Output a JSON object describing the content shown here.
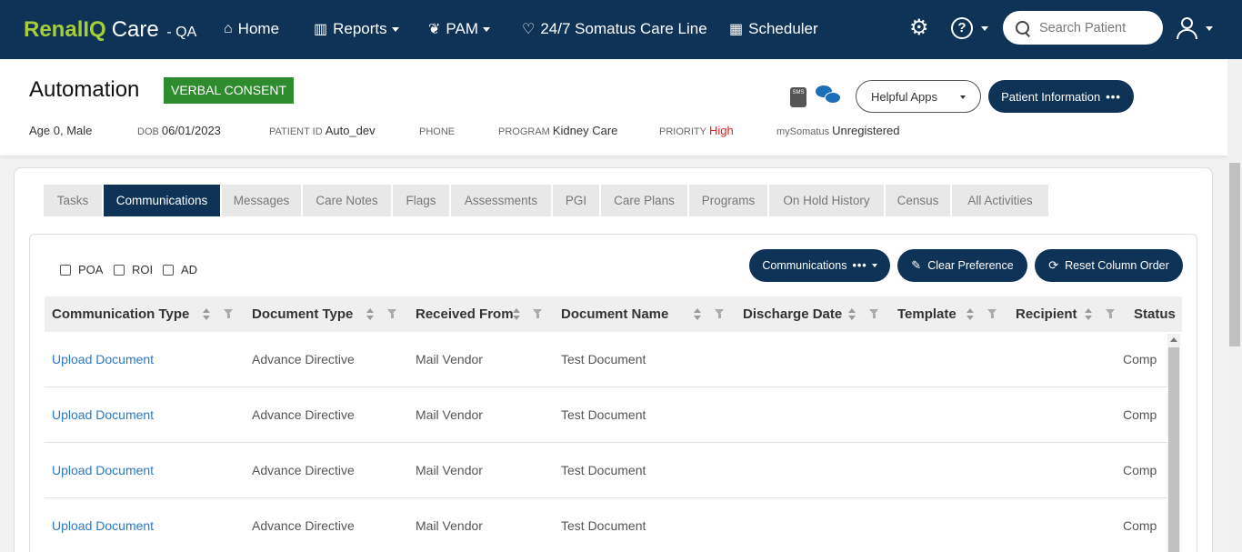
{
  "brand": {
    "part1": "Renal",
    "part2": "IQ",
    "part3": "Care",
    "env": "- QA"
  },
  "nav": {
    "home": "Home",
    "reports": "Reports",
    "pam": "PAM",
    "careline": "24/7 Somatus Care Line",
    "scheduler": "Scheduler",
    "search_placeholder": "Search Patient",
    "icons": [
      "home-icon",
      "bar-chart-icon",
      "leaf-icon",
      "heartbeat-icon",
      "calendar-icon",
      "gear-icon",
      "help-icon",
      "search-icon",
      "user-icon"
    ]
  },
  "patient": {
    "name": "Automation",
    "consent": "VERBAL CONSENT",
    "age_sex": "Age 0, Male",
    "dob_label": "DOB",
    "dob": "06/01/2023",
    "id_label": "PATIENT ID",
    "id": "Auto_dev",
    "phone_label": "PHONE",
    "program_label": "PROGRAM",
    "program": "Kidney Care",
    "priority_label": "PRIORITY",
    "priority": "High",
    "mysomatus_label": "mySomatus",
    "mysomatus": "Unregistered",
    "sms_label": "SMS",
    "helpful_apps": "Helpful Apps",
    "patient_info": "Patient Information",
    "dots": "•••"
  },
  "tabs": [
    "Tasks",
    "Communications",
    "Messages",
    "Care Notes",
    "Flags",
    "Assessments",
    "PGI",
    "Care Plans",
    "Programs",
    "On Hold History",
    "Census",
    "All Activities"
  ],
  "active_tab": "Communications",
  "filters": {
    "poa": "POA",
    "roi": "ROI",
    "ad": "AD"
  },
  "actions": {
    "communications": "Communications",
    "clear_pref": "Clear Preference",
    "reset_order": "Reset Column Order"
  },
  "table": {
    "columns": [
      "Communication Type",
      "Document Type",
      "Received From",
      "Document Name",
      "Discharge Date",
      "Template",
      "Recipient",
      "Status"
    ],
    "rows": [
      [
        "Upload Document",
        "Advance Directive",
        "Mail Vendor",
        "Test Document",
        "",
        "",
        "",
        "Comp"
      ],
      [
        "Upload Document",
        "Advance Directive",
        "Mail Vendor",
        "Test Document",
        "",
        "",
        "",
        "Comp"
      ],
      [
        "Upload Document",
        "Advance Directive",
        "Mail Vendor",
        "Test Document",
        "",
        "",
        "",
        "Comp"
      ],
      [
        "Upload Document",
        "Advance Directive",
        "Mail Vendor",
        "Test Document",
        "",
        "",
        "",
        "Comp"
      ]
    ]
  },
  "colors": {
    "navy": "#0e3356",
    "brand_green": "#a6ce39",
    "consent_green": "#2e8b2e",
    "link_blue": "#2a7ac8",
    "priority_red": "#e02020"
  }
}
